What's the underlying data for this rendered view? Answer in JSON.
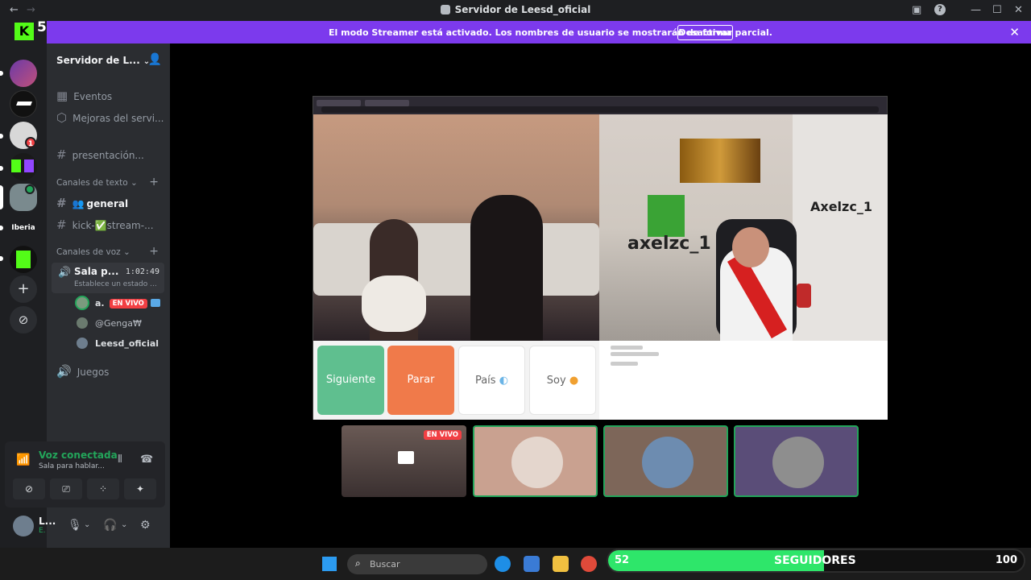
{
  "titlebar": {
    "title": "Servidor de Leesd_oficial"
  },
  "streamer_banner": {
    "message": "El modo Streamer está activado. Los nombres de usuario se mostrarán de forma parcial.",
    "button": "Desactivar"
  },
  "guild_list": {
    "top_badge": "5",
    "items": [
      {
        "name": "kick-server",
        "badge": ""
      },
      {
        "name": "avatar-server",
        "badge": ""
      },
      {
        "name": "logo-server",
        "badge": ""
      },
      {
        "name": "art-server",
        "badge": "1"
      },
      {
        "name": "kick-twitch-server",
        "badge": ""
      },
      {
        "name": "current-server",
        "badge": ""
      },
      {
        "name": "iberia-server",
        "label": "Iberia"
      },
      {
        "name": "kick-server-2",
        "badge": ""
      }
    ]
  },
  "sidebar": {
    "server_name": "Servidor de L...",
    "events": "Eventos",
    "boosts": "Mejoras del servi...",
    "presentation": "presentación...",
    "text_category": "Canales de texto",
    "general": "general",
    "kick_stream": "kick-✅stream-...",
    "voice_category": "Canales de voz",
    "active_voice": {
      "name": "Sala p...",
      "time": "1:02:49",
      "status": "Establece un estado ..."
    },
    "voice_users": [
      {
        "name": "a.",
        "live": "EN VIVO"
      },
      {
        "name": "@Genga₩",
        "live": ""
      },
      {
        "name": "Leesd_oficial",
        "live": ""
      }
    ],
    "games": "Juegos"
  },
  "voice_panel": {
    "title": "Voz conectada",
    "subtitle": "Sala para hablar..."
  },
  "userbar": {
    "name": "L...",
    "status": "E."
  },
  "stream": {
    "buttons": [
      {
        "label": "Siguiente",
        "color": "#5fbf8f"
      },
      {
        "label": "Parar",
        "color": "#f07a4a"
      },
      {
        "label": "País",
        "color": "#ffffff"
      },
      {
        "label": "Soy",
        "color": "#ffffff"
      }
    ],
    "cam2_text": "axelzc_1",
    "cam2_text_mirrored": "Axelzc_1"
  },
  "thumbnails": [
    {
      "name": "stream-thumb",
      "live": "EN VIVO"
    },
    {
      "name": "user-thumb-1"
    },
    {
      "name": "user-thumb-2"
    },
    {
      "name": "user-thumb-3"
    }
  ],
  "taskbar": {
    "search": "Buscar"
  },
  "follower_goal": {
    "current": "52",
    "label": "SEGUIDORES",
    "goal": "100",
    "progress": 0.52
  },
  "colors": {
    "discord_bg": "#1e1f22",
    "channel_bg": "#2b2d31",
    "streamer_purple": "#7c3aed",
    "voice_green": "#23a55a",
    "live_red": "#f23f43",
    "goal_green": "#2ee66a"
  }
}
